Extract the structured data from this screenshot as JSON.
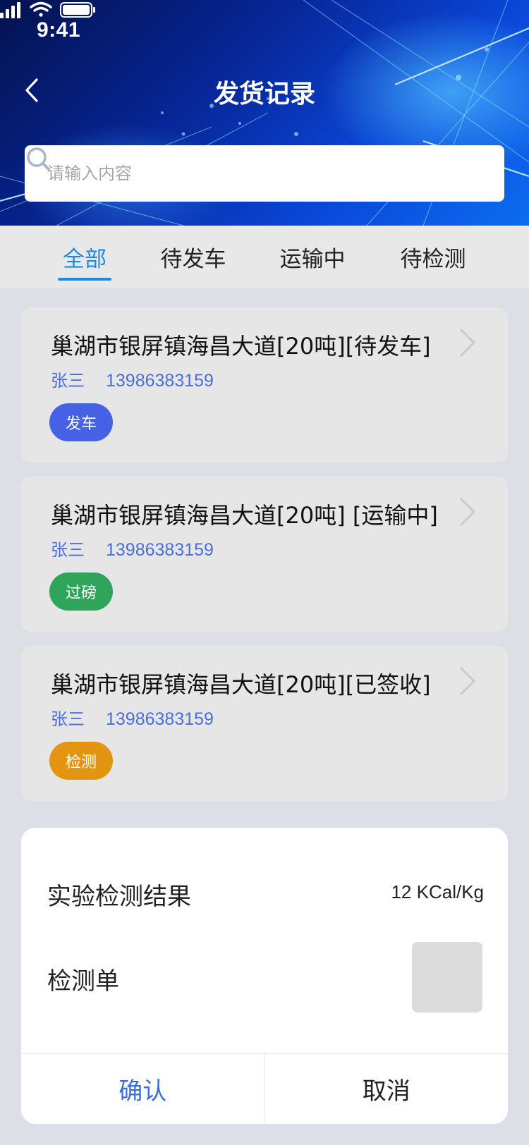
{
  "status_bar": {
    "time": "9:41"
  },
  "header": {
    "title": "发货记录",
    "search_placeholder": "请输入内容"
  },
  "tabs": [
    {
      "label": "全部",
      "active": true
    },
    {
      "label": "待发车",
      "active": false
    },
    {
      "label": "运输中",
      "active": false
    },
    {
      "label": "待检测",
      "active": false
    }
  ],
  "records": [
    {
      "title": "巢湖市银屏镇海昌大道[20吨][待发车]",
      "name": "张三",
      "phone": "13986383159",
      "action": "发车",
      "action_color": "#4462e3"
    },
    {
      "title": "巢湖市银屏镇海昌大道[20吨] [运输中]",
      "name": "张三",
      "phone": "13986383159",
      "action": "过磅",
      "action_color": "#2fa55c"
    },
    {
      "title": "巢湖市银屏镇海昌大道[20吨][已签收]",
      "name": "张三",
      "phone": "13986383159",
      "action": "检测",
      "action_color": "#e39410"
    }
  ],
  "dialog": {
    "result_label": "实验检测结果",
    "result_value": "12 KCal/Kg",
    "report_label": "检测单",
    "confirm_label": "确认",
    "cancel_label": "取消"
  },
  "colors": {
    "accent": "#1a8ce6",
    "link_blue": "#4a6fd8"
  }
}
